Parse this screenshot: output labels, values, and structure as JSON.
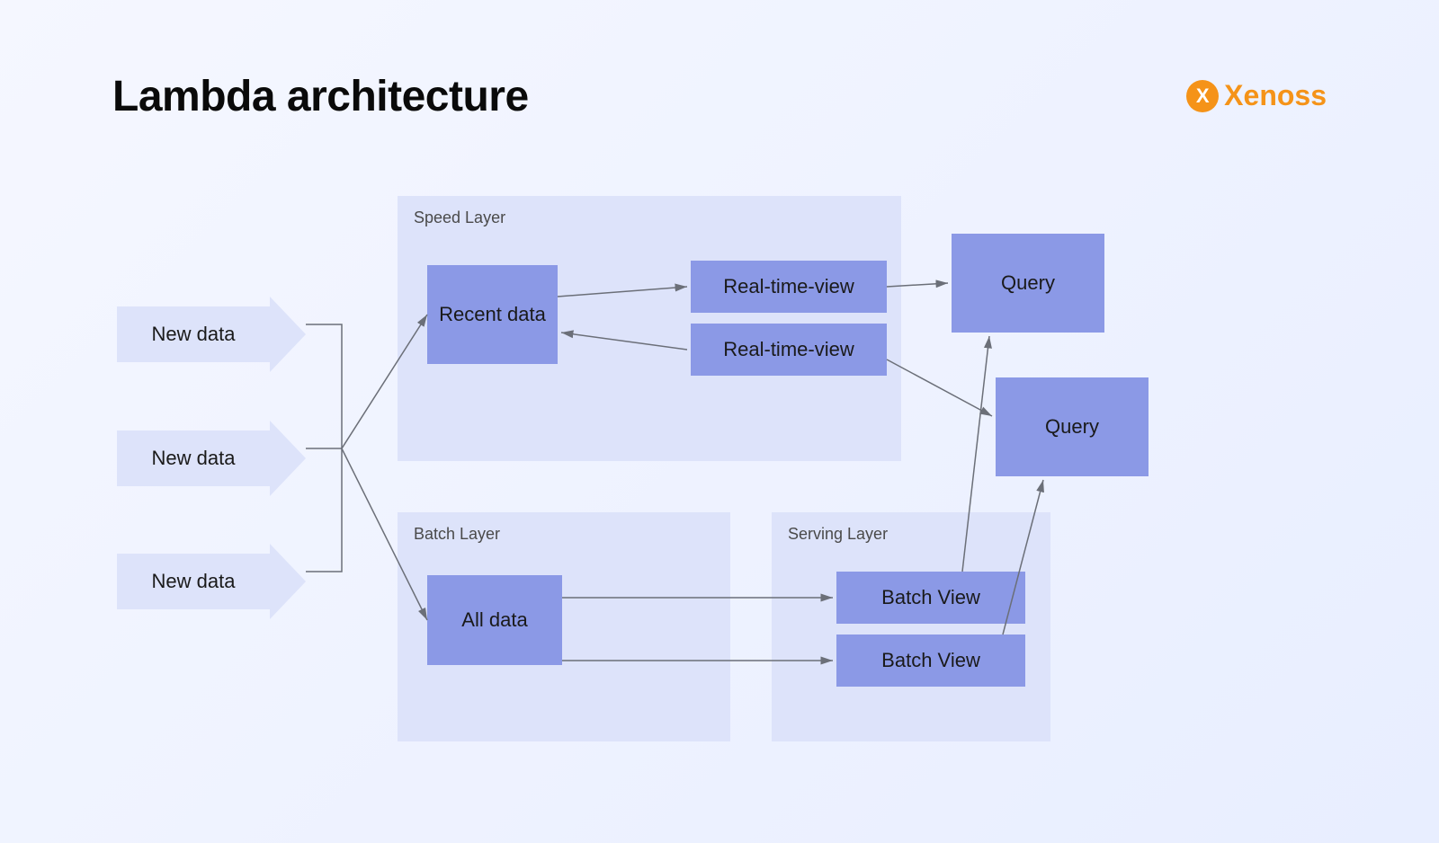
{
  "title": "Lambda architecture",
  "brand": {
    "name": "Xenoss",
    "icon_label": "X"
  },
  "colors": {
    "accent_brand": "#f59318",
    "layer_bg": "#dde3fa",
    "node_bg": "#8b99e6",
    "arrow_stroke": "#6b6f78"
  },
  "inputs": {
    "label_1": "New data",
    "label_2": "New data",
    "label_3": "New data"
  },
  "layers": {
    "speed": {
      "title": "Speed Layer",
      "recent_data": "Recent data",
      "rt_view_1": "Real-time-view",
      "rt_view_2": "Real-time-view"
    },
    "batch": {
      "title": "Batch Layer",
      "all_data": "All data"
    },
    "serving": {
      "title": "Serving Layer",
      "batch_view_1": "Batch View",
      "batch_view_2": "Batch View"
    }
  },
  "outputs": {
    "query_1": "Query",
    "query_2": "Query"
  },
  "connections": [
    {
      "from": "inputs",
      "to": "recent_data"
    },
    {
      "from": "inputs",
      "to": "all_data"
    },
    {
      "from": "recent_data",
      "to": "rt_view_1",
      "bidirectional_pair": "rt_view_2_back"
    },
    {
      "from": "rt_view_2",
      "to": "recent_data"
    },
    {
      "from": "all_data",
      "to": "batch_view_1"
    },
    {
      "from": "all_data",
      "to": "batch_view_2"
    },
    {
      "from": "rt_view_1",
      "to": "query_1"
    },
    {
      "from": "rt_view_2",
      "to": "query_2"
    },
    {
      "from": "batch_view_1",
      "to": "query_1"
    },
    {
      "from": "batch_view_2",
      "to": "query_2"
    }
  ]
}
